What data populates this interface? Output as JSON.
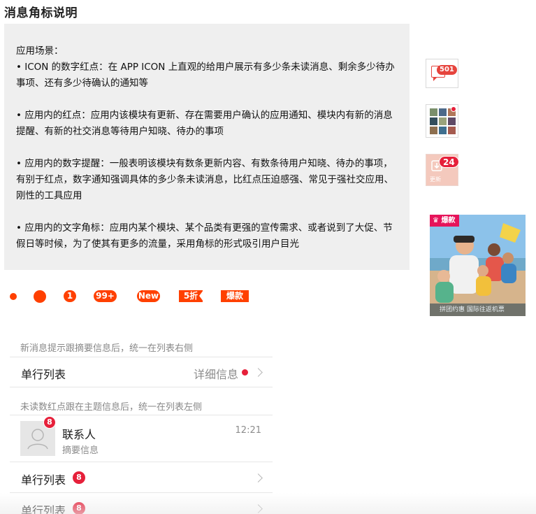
{
  "page": {
    "title": "消息角标说明"
  },
  "description": {
    "heading": "应用场景：",
    "items": [
      "•  ICON 的数字红点：在 APP ICON 上直观的给用户展示有多少条未读消息、剩余多少待办事项、还有多少待确认的通知等",
      "• 应用内的红点：应用内该模块有更新、存在需要用户确认的应用通知、模块内有新的消息提醒、有新的社交消息等待用户知晓、待办的事项",
      "• 应用内的数字提醒：一般表明该模块有数条更新内容、有数条待用户知晓、待办的事项，有别于红点，数字通知强调具体的多少条未读消息，比红点压迫感强、常见于强社交应用、刚性的工具应用",
      "• 应用内的文字角标：应用内某个模块、某个品类有更强的宣传需求、或者说到了大促、节假日等时候，为了使其有更多的流量，采用角标的形式吸引用户目光"
    ]
  },
  "samples": {
    "chat_badge": "501",
    "update_badge": "24",
    "update_label": "更新",
    "promo_tag": "爆款",
    "promo_caption": "拼团约惠 国际往返机票"
  },
  "badges": {
    "one": "1",
    "ninety_nine": "99+",
    "new": "New",
    "discount": "5折",
    "hot": "爆款"
  },
  "list": {
    "caption_right": "新消息提示跟摘要信息后，统一在列表右侧",
    "row1_title": "单行列表",
    "row1_detail": "详细信息",
    "caption_left": "未读数红点跟在主题信息后，统一在列表左侧",
    "contact_name": "联系人",
    "contact_summary": "摘要信息",
    "contact_time": "12:21",
    "contact_badge": "8",
    "row3_title": "单行列表",
    "row3_badge": "8",
    "row4_title": "单行列表",
    "row4_badge": "8"
  },
  "colors": {
    "badge_orange": "#ff4000",
    "badge_red": "#e6203a",
    "promo_pink": "#e6145a"
  }
}
